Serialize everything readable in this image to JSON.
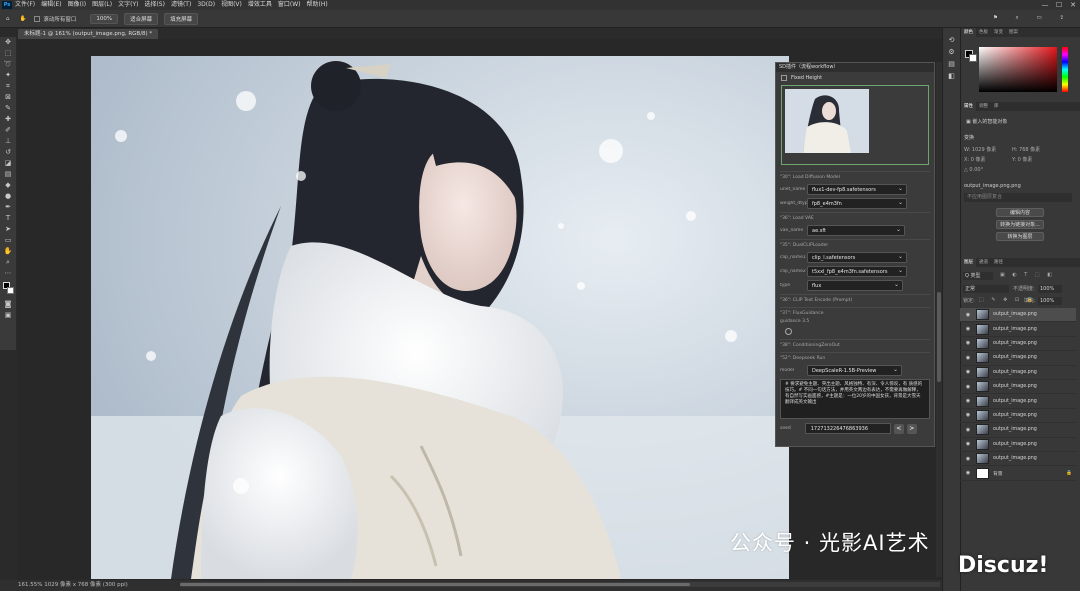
{
  "menubar": {
    "items": [
      "文件(F)",
      "编辑(E)",
      "图像(I)",
      "图层(L)",
      "文字(Y)",
      "选择(S)",
      "滤镜(T)",
      "3D(D)",
      "视图(V)",
      "增效工具",
      "窗口(W)",
      "帮助(H)"
    ]
  },
  "window_controls": {
    "minimize": "—",
    "maximize": "☐",
    "close": "✕"
  },
  "options": {
    "scroll_all": "滚动所有窗口",
    "zoom": "100%",
    "fit_screen": "适合屏幕",
    "fill_screen": "填充屏幕"
  },
  "document": {
    "tab": "未标题-1 @ 161% (output_image.png, RGB/8) *",
    "status": "161.55%  1029 像素 x 768 像素 (300 ppi)"
  },
  "comfy": {
    "title": "SD插件（流程workflow）",
    "fixed_height": "Fixed Height",
    "nodes": [
      {
        "label": "\"30\": Load Diffusion Model",
        "fields": [
          {
            "k": "unet_name",
            "v": "flux1-dev-fp8.safetensors"
          },
          {
            "k": "weight_dtype",
            "v": "fp8_e4m3fn"
          }
        ]
      },
      {
        "label": "\"36\": Load VAE",
        "fields": [
          {
            "k": "vae_name",
            "v": "ae.sft"
          }
        ]
      },
      {
        "label": "\"35\": DualCLIPLoader",
        "fields": [
          {
            "k": "clip_name1",
            "v": "clip_l.safetensors"
          },
          {
            "k": "clip_name2",
            "v": "t5xxl_fp8_e4m3fn.safetensors"
          },
          {
            "k": "type",
            "v": "flux"
          }
        ]
      },
      {
        "label": "\"36\": CLIP Text Encode (Prompt)",
        "fields": []
      },
      {
        "label": "\"37\": FluxGuidance",
        "fields": [
          {
            "k": "guidance",
            "v": "3.5"
          }
        ]
      },
      {
        "label": "\"38\": ConditioningZeroOut",
        "fields": []
      },
      {
        "label": "\"52\": Deepseek Run",
        "fields": [
          {
            "k": "model",
            "v": "DeepScaleR-1.5B-Preview"
          }
        ]
      }
    ],
    "prompt": "# 要求避免主题、突出主题、风格独特、有深、令人惊叹，有 质感的技巧。# 不同一句话方法，并用英文两边有表达，不需要再做解释，有自然写实画面感，#主题是：一位20岁的中国女孩，背景是大雪天 翻译成英文输出",
    "seed_label": "seed",
    "seed": "172713226476863936",
    "prev": "<",
    "next": ">"
  },
  "panels": {
    "color_tabs": [
      "颜色",
      "色板",
      "渐变",
      "图案"
    ],
    "props_tabs": [
      "属性",
      "调整",
      "库"
    ],
    "smart_object": "嵌入的智能对象",
    "transform": "变换",
    "w": "W:  1029 像素",
    "h": "H:  768 像素",
    "x": "X:  0 像素",
    "y": "Y:  0 像素",
    "angle": "△  0.00°",
    "filename": "output_image.png.png",
    "no_comps": "不应用图层复合",
    "btn_edit": "编辑内容",
    "btn_link": "转换为链接对象...",
    "btn_layers": "转换为图层",
    "layers_tabs": [
      "图层",
      "通道",
      "路径"
    ],
    "kind": "Q 类型",
    "blend": "正常",
    "opacity_label": "不透明度:",
    "opacity": "100%",
    "lock_label": "锁定:",
    "fill_label": "填充:",
    "fill": "100%",
    "layers": [
      "output_image.png",
      "output_image.png",
      "output_image.png",
      "output_image.png",
      "output_image.png",
      "output_image.png",
      "output_image.png",
      "output_image.png",
      "output_image.png",
      "output_image.png",
      "output_image.png",
      "背景"
    ]
  },
  "watermark": {
    "text": "公众号 · 光影AI艺术",
    "site": "Discuz!"
  }
}
